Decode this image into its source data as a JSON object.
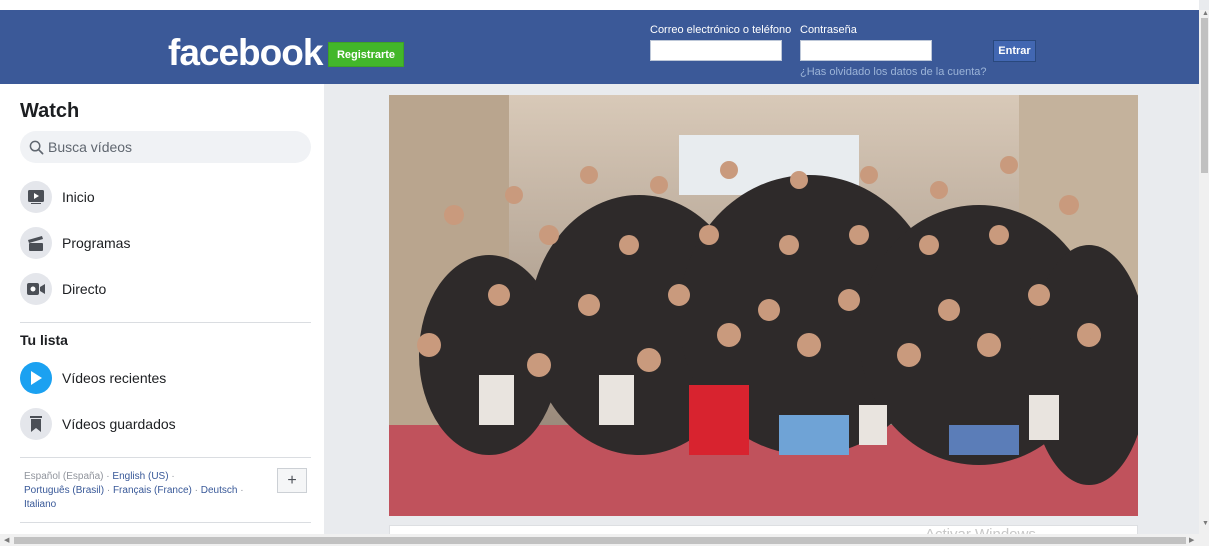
{
  "header": {
    "logo": "facebook",
    "register_label": "Registrarte",
    "email_label": "Correo electrónico o teléfono",
    "password_label": "Contraseña",
    "login_label": "Entrar",
    "forgot_link": "¿Has olvidado los datos de la cuenta?"
  },
  "sidebar": {
    "title": "Watch",
    "search_placeholder": "Busca vídeos",
    "nav": [
      {
        "label": "Inicio"
      },
      {
        "label": "Programas"
      },
      {
        "label": "Directo"
      }
    ],
    "list_title": "Tu lista",
    "list": [
      {
        "label": "Vídeos recientes"
      },
      {
        "label": "Vídeos guardados"
      }
    ],
    "languages": {
      "current": "Español (España)",
      "english": "English (US)",
      "portuguese": "Português (Brasil)",
      "french": "Français (France)",
      "german": "Deutsch",
      "italian": "Italiano",
      "separator": "·",
      "add_label": "+"
    }
  },
  "watermark": "Activar Windows",
  "colors": {
    "brand": "#3b5998",
    "register": "#42b72a",
    "accent_blue": "#1ba1f1"
  }
}
